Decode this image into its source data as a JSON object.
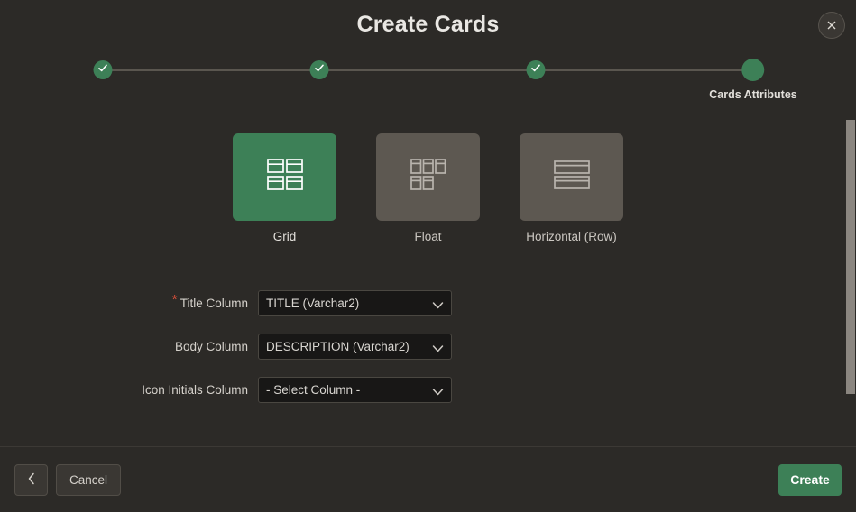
{
  "dialog": {
    "title": "Create Cards",
    "close_icon": "close-icon"
  },
  "stepper": {
    "steps": [
      {
        "label": "",
        "state": "complete",
        "icon": "check-icon"
      },
      {
        "label": "",
        "state": "complete",
        "icon": "check-icon"
      },
      {
        "label": "",
        "state": "complete",
        "icon": "check-icon"
      },
      {
        "label": "Cards Attributes",
        "state": "current",
        "icon": ""
      }
    ]
  },
  "card_types": {
    "options": [
      {
        "label": "Grid",
        "icon": "grid-layout-icon",
        "selected": true
      },
      {
        "label": "Float",
        "icon": "float-layout-icon",
        "selected": false
      },
      {
        "label": "Horizontal (Row)",
        "icon": "horizontal-row-layout-icon",
        "selected": false
      }
    ]
  },
  "form": {
    "fields": [
      {
        "label": "Title Column",
        "required": true,
        "required_mark": "*",
        "value": "TITLE (Varchar2)"
      },
      {
        "label": "Body Column",
        "required": false,
        "required_mark": "",
        "value": "DESCRIPTION (Varchar2)"
      },
      {
        "label": "Icon Initials Column",
        "required": false,
        "required_mark": "",
        "value": "- Select Column -"
      }
    ]
  },
  "footer": {
    "back_label": "",
    "back_icon": "chevron-left-icon",
    "cancel_label": "Cancel",
    "create_label": "Create"
  },
  "colors": {
    "background": "#2c2a27",
    "accent_green": "#3d8057",
    "tile_inactive": "#5d5851",
    "required_star": "#e0503a",
    "text_primary": "#d8d5d0",
    "scrollbar_thumb": "#8b8680"
  }
}
